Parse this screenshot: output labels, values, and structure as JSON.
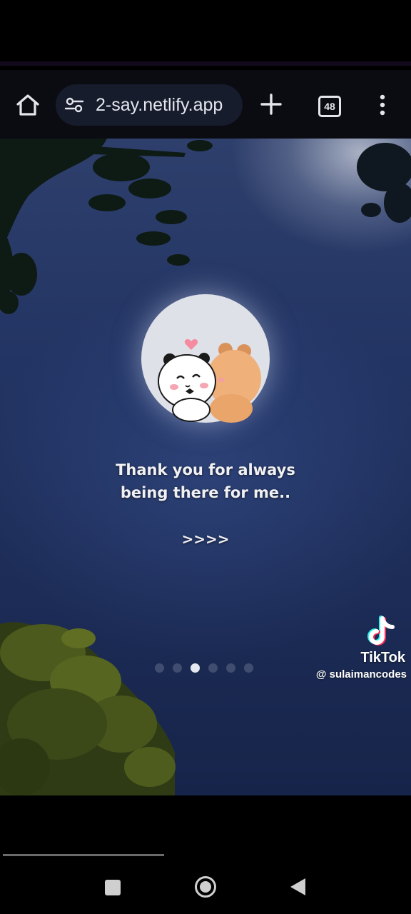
{
  "browser": {
    "url": "2-say.netlify.app",
    "tab_count": "48",
    "icons": {
      "home": "home-icon",
      "site_settings": "tune-icon",
      "new_tab": "plus-icon",
      "menu": "more-vert-icon"
    }
  },
  "slide": {
    "message_line1": "Thank you for always",
    "message_line2": "being there for me..",
    "next_arrows": ">>>>",
    "dots_total": 6,
    "active_dot": 3
  },
  "watermark": {
    "brand": "TikTok",
    "username": "@ sulaimancodes"
  },
  "colors": {
    "sky": "#223463",
    "url_pill": "#161c2c",
    "text": "#f1f1f3"
  }
}
